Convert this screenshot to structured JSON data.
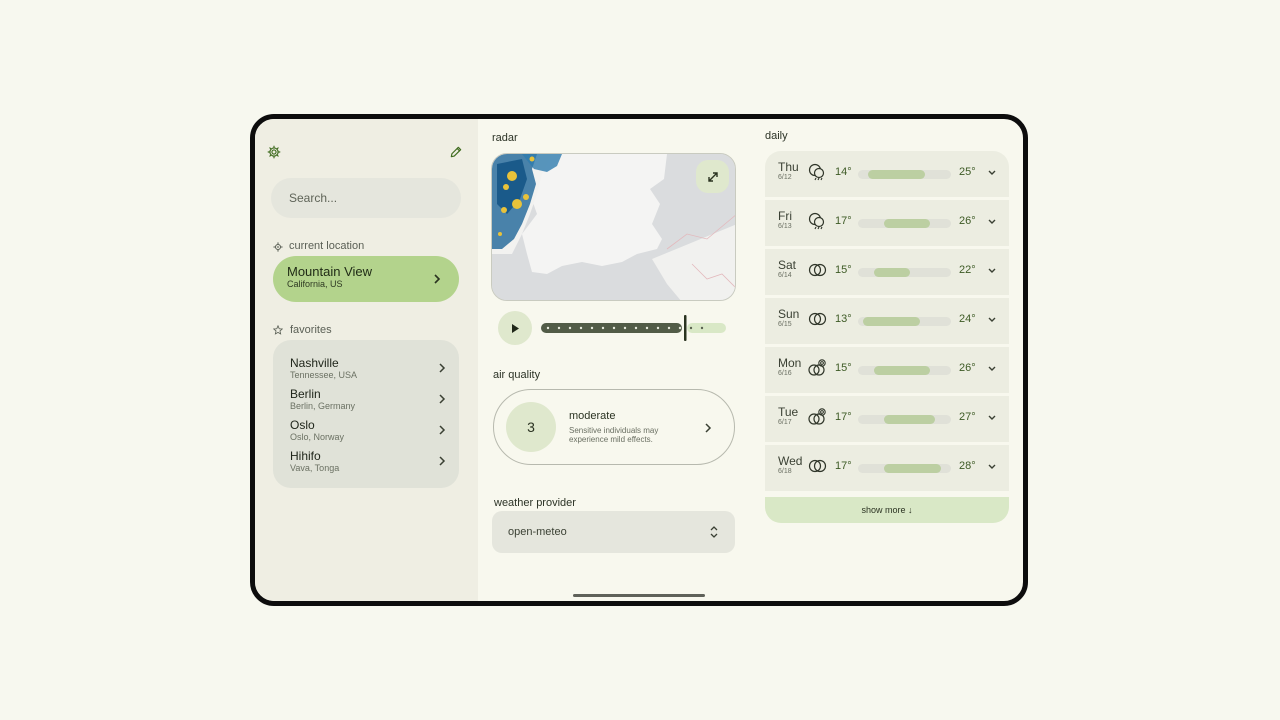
{
  "sidebar": {
    "search_placeholder": "Search...",
    "current_location_label": "current location",
    "current": {
      "name": "Mountain View",
      "sub": "California, US"
    },
    "favorites_label": "favorites",
    "favorites": [
      {
        "name": "Nashville",
        "sub": "Tennessee, USA"
      },
      {
        "name": "Berlin",
        "sub": "Berlin, Germany"
      },
      {
        "name": "Oslo",
        "sub": "Oslo, Norway"
      },
      {
        "name": "Hihifo",
        "sub": "Vava, Tonga"
      }
    ]
  },
  "radar": {
    "label": "radar",
    "timeline_progress": 0.83
  },
  "air_quality": {
    "label": "air quality",
    "index": "3",
    "level": "moderate",
    "description_line1": "Sensitive individuals may",
    "description_line2": "experience mild effects."
  },
  "provider": {
    "label": "weather provider",
    "value": "open-meteo"
  },
  "daily": {
    "label": "daily",
    "range": [
      12,
      30
    ],
    "days": [
      {
        "day": "Thu",
        "date": "6/12",
        "low": "14°",
        "high": "25°",
        "lo": 14,
        "hi": 25,
        "icon": "rain-icon"
      },
      {
        "day": "Fri",
        "date": "6/13",
        "low": "17°",
        "high": "26°",
        "lo": 17,
        "hi": 26,
        "icon": "rain-icon"
      },
      {
        "day": "Sat",
        "date": "6/14",
        "low": "15°",
        "high": "22°",
        "lo": 15,
        "hi": 22,
        "icon": "cloudy-icon"
      },
      {
        "day": "Sun",
        "date": "6/15",
        "low": "13°",
        "high": "24°",
        "lo": 13,
        "hi": 24,
        "icon": "cloudy-icon"
      },
      {
        "day": "Mon",
        "date": "6/16",
        "low": "15°",
        "high": "26°",
        "lo": 15,
        "hi": 26,
        "icon": "partly-sunny-icon"
      },
      {
        "day": "Tue",
        "date": "6/17",
        "low": "17°",
        "high": "27°",
        "lo": 17,
        "hi": 27,
        "icon": "partly-sunny-icon"
      },
      {
        "day": "Wed",
        "date": "6/18",
        "low": "17°",
        "high": "28°",
        "lo": 17,
        "hi": 28,
        "icon": "cloudy-icon"
      }
    ],
    "show_more": "show more ↓"
  },
  "colors": {
    "accent": "#b3d38c",
    "surface": "#efeee3",
    "bar": "#bccfa2"
  }
}
